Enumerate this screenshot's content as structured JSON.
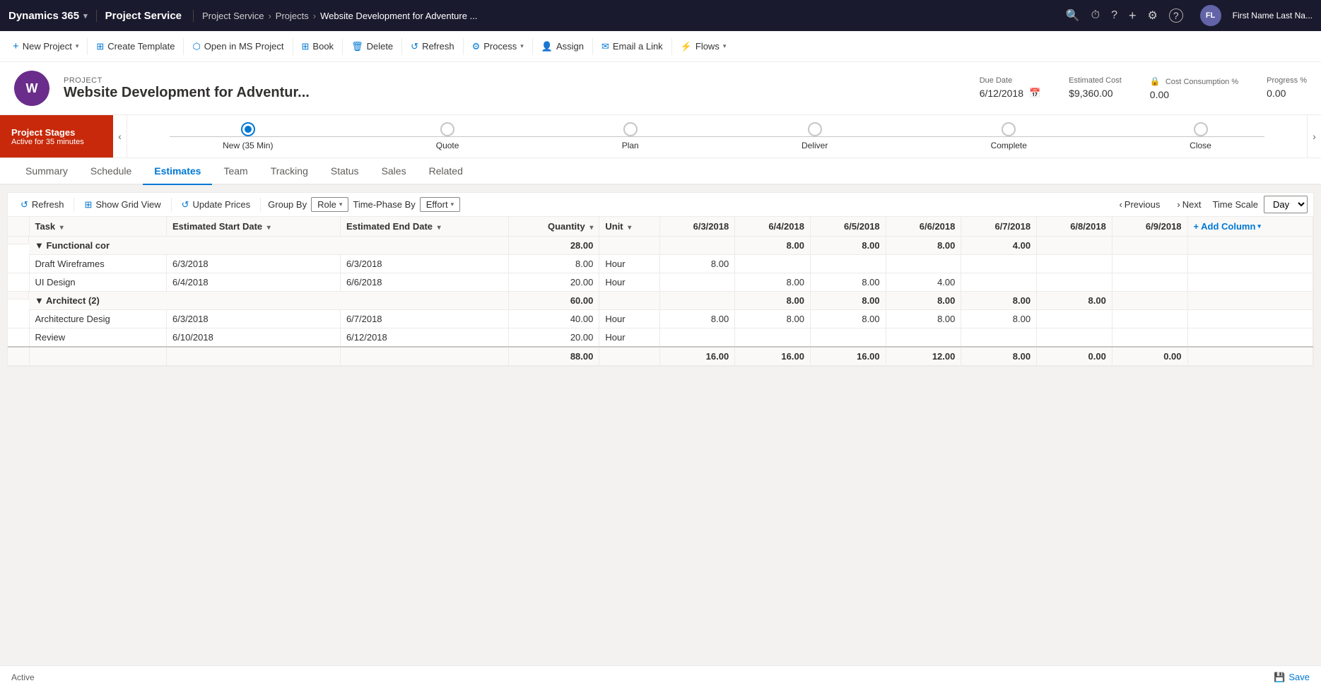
{
  "topNav": {
    "brand": "Dynamics 365",
    "brandArrow": "▾",
    "module": "Project Service",
    "breadcrumb": [
      "Project Service",
      "Projects",
      "Website Development for Adventure ..."
    ],
    "userInitials": "FL",
    "userName": "First Name Last Na..."
  },
  "commandBar": {
    "buttons": [
      {
        "id": "new-project",
        "icon": "+",
        "label": "New Project",
        "hasArrow": true
      },
      {
        "id": "create-template",
        "icon": "⊞",
        "label": "Create Template",
        "hasArrow": false
      },
      {
        "id": "open-ms-project",
        "icon": "✦",
        "label": "Open in MS Project",
        "hasArrow": false
      },
      {
        "id": "book",
        "icon": "⊞",
        "label": "Book",
        "hasArrow": false
      },
      {
        "id": "delete",
        "icon": "🗑",
        "label": "Delete",
        "hasArrow": false
      },
      {
        "id": "refresh",
        "icon": "↺",
        "label": "Refresh",
        "hasArrow": false
      },
      {
        "id": "process",
        "icon": "⚙",
        "label": "Process",
        "hasArrow": true
      },
      {
        "id": "assign",
        "icon": "👤",
        "label": "Assign",
        "hasArrow": false
      },
      {
        "id": "email-link",
        "icon": "✉",
        "label": "Email a Link",
        "hasArrow": false
      },
      {
        "id": "flows",
        "icon": "⚡",
        "label": "Flows",
        "hasArrow": true
      }
    ]
  },
  "project": {
    "label": "PROJECT",
    "title": "Website Development for Adventur...",
    "avatarLetter": "W",
    "dueDate": {
      "label": "Due Date",
      "value": "6/12/2018"
    },
    "estimatedCost": {
      "label": "Estimated Cost",
      "value": "$9,360.00"
    },
    "costConsumption": {
      "label": "Cost Consumption %",
      "value": "0.00",
      "hasLock": true
    },
    "progress": {
      "label": "Progress %",
      "value": "0.00"
    }
  },
  "projectStages": {
    "label": "Project Stages",
    "sublabel": "Active for 35 minutes",
    "stages": [
      {
        "name": "New (35 Min)",
        "active": true
      },
      {
        "name": "Quote",
        "active": false
      },
      {
        "name": "Plan",
        "active": false
      },
      {
        "name": "Deliver",
        "active": false
      },
      {
        "name": "Complete",
        "active": false
      },
      {
        "name": "Close",
        "active": false
      }
    ]
  },
  "tabs": [
    {
      "id": "summary",
      "label": "Summary",
      "active": false
    },
    {
      "id": "schedule",
      "label": "Schedule",
      "active": false
    },
    {
      "id": "estimates",
      "label": "Estimates",
      "active": true
    },
    {
      "id": "team",
      "label": "Team",
      "active": false
    },
    {
      "id": "tracking",
      "label": "Tracking",
      "active": false
    },
    {
      "id": "status",
      "label": "Status",
      "active": false
    },
    {
      "id": "sales",
      "label": "Sales",
      "active": false
    },
    {
      "id": "related",
      "label": "Related",
      "active": false
    }
  ],
  "estimatesToolbar": {
    "refresh": "Refresh",
    "showGridView": "Show Grid View",
    "updatePrices": "Update Prices",
    "groupByLabel": "Group By",
    "groupByValue": "Role",
    "timePhasedLabel": "Time-Phase By",
    "timePhasedValue": "Effort",
    "previous": "Previous",
    "next": "Next",
    "timeScaleLabel": "Time Scale",
    "timeScaleValue": "Day"
  },
  "tableHeaders": {
    "task": "Task",
    "estimatedStartDate": "Estimated Start Date",
    "estimatedEndDate": "Estimated End Date",
    "quantity": "Quantity",
    "unit": "Unit",
    "col_6_3": "6/3/2018",
    "col_6_4": "6/4/2018",
    "col_6_5": "6/5/2018",
    "col_6_6": "6/6/2018",
    "col_6_7": "6/7/2018",
    "col_6_8": "6/8/2018",
    "col_6_9": "6/9/2018",
    "addColumn": "Add Column"
  },
  "groups": [
    {
      "id": "functional",
      "name": "Functional cor",
      "quantity": "28.00",
      "unit": "",
      "col_6_3": "",
      "col_6_4": "8.00",
      "col_6_5": "8.00",
      "col_6_6": "8.00",
      "col_6_7": "4.00",
      "col_6_8": "",
      "col_6_9": "",
      "rows": [
        {
          "task": "Draft Wireframes",
          "startDate": "6/3/2018",
          "endDate": "6/3/2018",
          "quantity": "8.00",
          "unit": "Hour",
          "col_6_3": "8.00",
          "col_6_4": "",
          "col_6_5": "",
          "col_6_6": "",
          "col_6_7": "",
          "col_6_8": "",
          "col_6_9": ""
        },
        {
          "task": "UI Design",
          "startDate": "6/4/2018",
          "endDate": "6/6/2018",
          "quantity": "20.00",
          "unit": "Hour",
          "col_6_3": "",
          "col_6_4": "8.00",
          "col_6_5": "8.00",
          "col_6_6": "4.00",
          "col_6_7": "",
          "col_6_8": "",
          "col_6_9": ""
        }
      ]
    },
    {
      "id": "architect",
      "name": "Architect (2)",
      "quantity": "60.00",
      "unit": "",
      "col_6_3": "",
      "col_6_4": "8.00",
      "col_6_5": "8.00",
      "col_6_6": "8.00",
      "col_6_7": "8.00",
      "col_6_8": "8.00",
      "col_6_9": "",
      "rows": [
        {
          "task": "Architecture Desig",
          "startDate": "6/3/2018",
          "endDate": "6/7/2018",
          "quantity": "40.00",
          "unit": "Hour",
          "col_6_3": "8.00",
          "col_6_4": "8.00",
          "col_6_5": "8.00",
          "col_6_6": "8.00",
          "col_6_7": "8.00",
          "col_6_8": "",
          "col_6_9": ""
        },
        {
          "task": "Review",
          "startDate": "6/10/2018",
          "endDate": "6/12/2018",
          "quantity": "20.00",
          "unit": "Hour",
          "col_6_3": "",
          "col_6_4": "",
          "col_6_5": "",
          "col_6_6": "",
          "col_6_7": "",
          "col_6_8": "",
          "col_6_9": ""
        }
      ]
    }
  ],
  "totalsRow": {
    "quantity": "88.00",
    "col_6_3": "16.00",
    "col_6_4": "16.00",
    "col_6_5": "16.00",
    "col_6_6": "12.00",
    "col_6_7": "8.00",
    "col_6_8": "0.00",
    "col_6_9": "0.00"
  },
  "footer": {
    "status": "Active",
    "saveLabel": "💾  Save"
  }
}
